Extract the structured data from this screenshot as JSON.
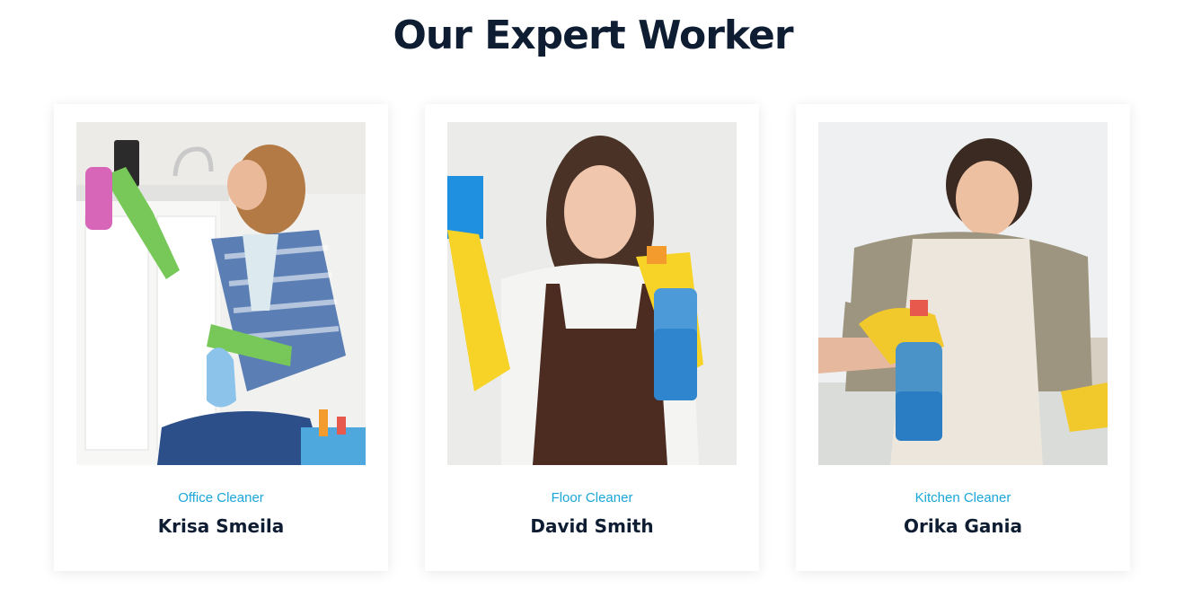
{
  "section": {
    "title": "Our Expert Worker"
  },
  "workers": [
    {
      "role": "Office Cleaner",
      "name": "Krisa Smeila",
      "photo": "woman-wiping-cabinet-photo"
    },
    {
      "role": "Floor Cleaner",
      "name": "David Smith",
      "photo": "woman-with-spray-and-sponge-photo"
    },
    {
      "role": "Kitchen Cleaner",
      "name": "Orika Gania",
      "photo": "woman-cleaning-window-photo"
    }
  ],
  "colors": {
    "title": "#0f1d33",
    "role": "#1aa6d8",
    "name": "#0f1d33",
    "card_background": "#ffffff"
  }
}
